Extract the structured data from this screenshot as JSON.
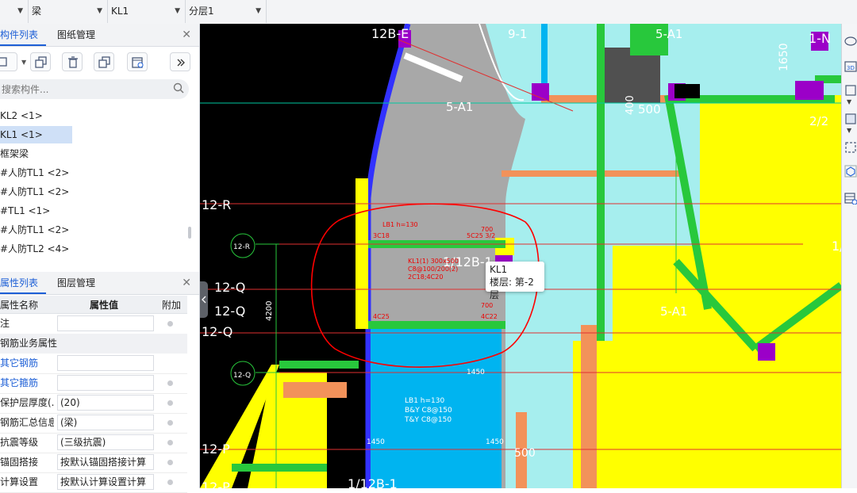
{
  "toolbar": {
    "dropdowns": [
      {
        "value": ""
      },
      {
        "value": "梁"
      },
      {
        "value": "KL1"
      },
      {
        "value": "分层1"
      }
    ]
  },
  "component_panel": {
    "tabs": [
      "构件列表",
      "图纸管理"
    ],
    "search_placeholder": "搜索构件...",
    "items": [
      {
        "label": "KL2 <1>"
      },
      {
        "label": "KL1 <1>",
        "selected": true
      },
      {
        "label": "框架梁"
      },
      {
        "label": "#人防TL1 <2>"
      },
      {
        "label": "#人防TL1 <2>"
      },
      {
        "label": "#TL1 <1>"
      },
      {
        "label": "#人防TL1 <2>"
      },
      {
        "label": "#人防TL2 <4>"
      }
    ]
  },
  "property_panel": {
    "tabs": [
      "属性列表",
      "图层管理"
    ],
    "columns": [
      "属性名称",
      "属性值",
      "附加"
    ],
    "rows": [
      {
        "name": "注",
        "value": "",
        "type": "row",
        "dot": true
      },
      {
        "name": "钢筋业务属性",
        "type": "group"
      },
      {
        "name": "其它钢筋",
        "value": "",
        "type": "row",
        "blue": true,
        "dot": false
      },
      {
        "name": "其它箍筋",
        "value": "",
        "type": "row",
        "blue": true,
        "dot": true
      },
      {
        "name": "保护层厚度(...",
        "value": "(20)",
        "type": "row",
        "dot": true
      },
      {
        "name": "钢筋汇总信息",
        "value": "(梁)",
        "type": "row",
        "dot": true
      },
      {
        "name": "抗震等级",
        "value": "(三级抗震)",
        "type": "row",
        "dot": true
      },
      {
        "name": "锚固搭接",
        "value": "按默认锚固搭接计算",
        "type": "row",
        "dot": true
      },
      {
        "name": "计算设置",
        "value": "按默认计算设置计算",
        "type": "row",
        "dot": true
      }
    ]
  },
  "canvas": {
    "grid_labels": [
      "12B-E",
      "9-1",
      "5-A1",
      "1-N",
      "5-A1",
      "1650",
      "400",
      "500",
      "2/2",
      "12-R",
      "12-R",
      "1/12B-1",
      "12-Q",
      "12-Q",
      "12-Q",
      "4200",
      "5-A1",
      "1/",
      "12-Q",
      "12-P",
      "500",
      "1/12B-1",
      "12-P"
    ],
    "cad_text": [
      "KL1(1) 300x500",
      "C8@100/200(2)",
      "2C18;4C20",
      "LB1 h=130",
      "LB1 h=130",
      "B&Y C8@150",
      "T&Y C8@150",
      "1450",
      "1450",
      "1450",
      "700",
      "700",
      "5C25 3/2",
      "3C18",
      "4C25",
      "4C22"
    ],
    "tooltip_lines": [
      "KL1",
      "楼层: 第-2层"
    ]
  },
  "colors": {
    "cad_background": "#000000",
    "slab_cyan": "#a6eeee",
    "beam_green": "#28c83c",
    "column_magenta": "#9b00c8",
    "wall_yellow": "#ffff00",
    "highlight_blue": "#00b4f0",
    "ramp_gray": "#a8a8a8",
    "selection_ring": "#ff0000",
    "tab_active": "#1d5fd6"
  },
  "right_toolbar_icons": [
    "cylinder-icon",
    "3d-view-icon",
    "cube-icon",
    "box-view-icon",
    "dashed-select-icon",
    "shield-cube-icon",
    "table-settings-icon"
  ]
}
